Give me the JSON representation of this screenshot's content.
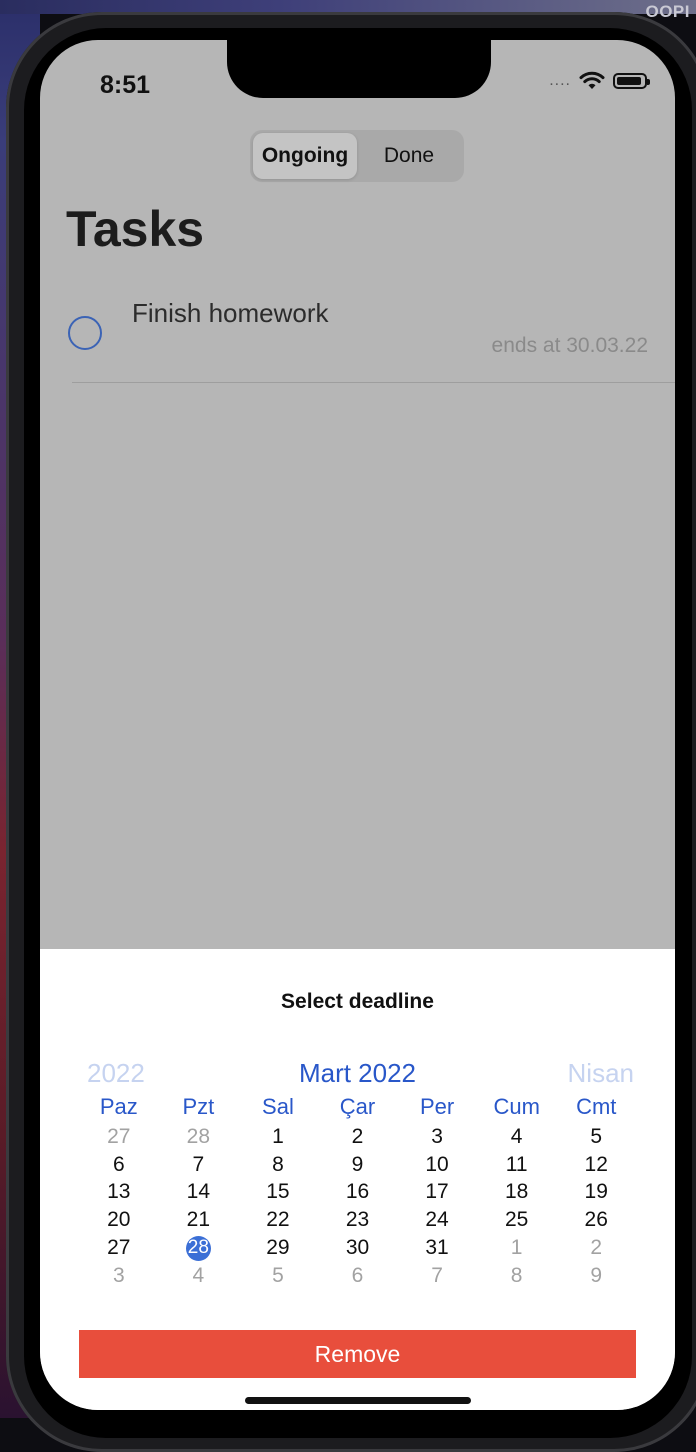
{
  "corner_label": "OOPI",
  "status": {
    "time": "8:51",
    "signal": "....",
    "wifi_icon": "wifi-icon",
    "battery_icon": "battery-icon"
  },
  "segment": {
    "items": [
      "Ongoing",
      "Done"
    ],
    "selected": "Ongoing"
  },
  "title": "Tasks",
  "tasks": [
    {
      "title": "Finish homework",
      "subtitle": "ends at 30.03.22"
    }
  ],
  "sheet": {
    "title": "Select deadline",
    "calendar": {
      "prev": "2022",
      "current": "Mart 2022",
      "next": "Nisan",
      "weekdays": [
        "Paz",
        "Pzt",
        "Sal",
        "Çar",
        "Per",
        "Cum",
        "Cmt"
      ],
      "weeks": [
        [
          "27",
          "28",
          "1",
          "2",
          "3",
          "4",
          "5"
        ],
        [
          "6",
          "7",
          "8",
          "9",
          "10",
          "11",
          "12"
        ],
        [
          "13",
          "14",
          "15",
          "16",
          "17",
          "18",
          "19"
        ],
        [
          "20",
          "21",
          "22",
          "23",
          "24",
          "25",
          "26"
        ],
        [
          "27",
          "28",
          "29",
          "30",
          "31",
          "1",
          "2"
        ],
        [
          "3",
          "4",
          "5",
          "6",
          "7",
          "8",
          "9"
        ]
      ],
      "selected_day": "28"
    },
    "remove_label": "Remove"
  },
  "colors": {
    "accent": "#2957c9",
    "remove": "#e84e3c",
    "overlay": "#b6b6b6"
  }
}
